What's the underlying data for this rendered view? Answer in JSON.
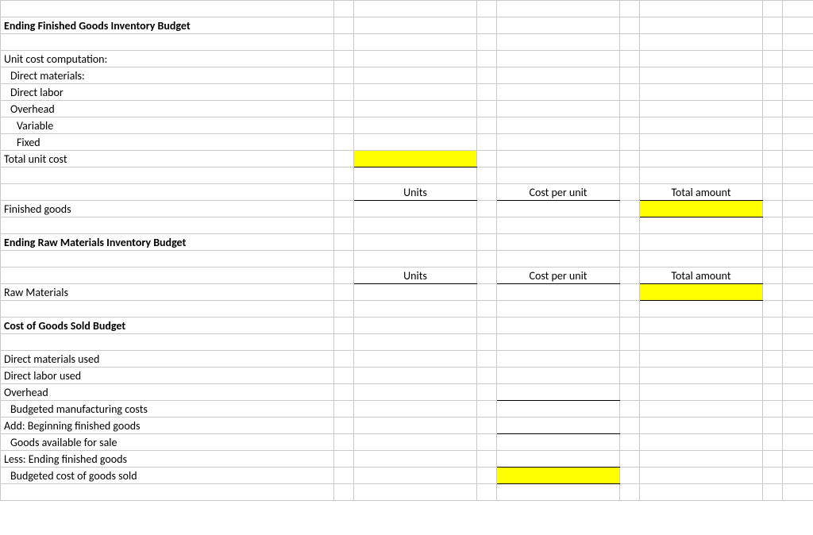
{
  "rows": {
    "r1": "Ending Finished Goods Inventory Budget",
    "r3": "Unit cost computation:",
    "r4": "Direct materials:",
    "r5": "Direct labor",
    "r6": "Overhead",
    "r7": "Variable",
    "r8": "Fixed",
    "r9": "Total unit cost",
    "h_units": "Units",
    "h_cpu": "Cost per unit",
    "h_total": "Total amount",
    "r12": "Finished goods",
    "r14": "Ending Raw Materials Inventory Budget",
    "r17": "Raw Materials",
    "r19": "Cost of Goods Sold Budget",
    "r21": "Direct materials used",
    "r22": "Direct labor used",
    "r23": "Overhead",
    "r24": "Budgeted manufacturing costs",
    "r25": "Add: Beginning finished goods",
    "r26": "Goods available for sale",
    "r27": "Less: Ending finished goods",
    "r28": "Budgeted cost of goods sold"
  }
}
